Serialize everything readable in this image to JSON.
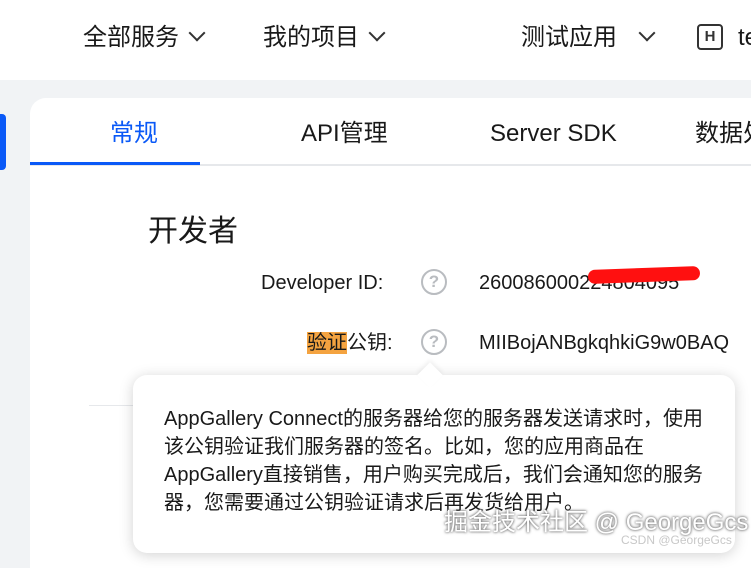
{
  "topnav": {
    "all_services": "全部服务",
    "my_projects": "我的项目",
    "app_selector": "测试应用",
    "user_badge": "H",
    "user_name_truncated": "te"
  },
  "tabs": [
    {
      "label": "常规",
      "active": true
    },
    {
      "label": "API管理",
      "active": false
    },
    {
      "label": "Server SDK",
      "active": false
    },
    {
      "label": "数据处",
      "active": false
    }
  ],
  "developer_section": {
    "title": "开发者",
    "fields": [
      {
        "label": "Developer ID:",
        "value": "260086000224804095"
      },
      {
        "label_highlight": "验证",
        "label_rest": "公钥:",
        "value": "MIIBojANBgkqhkiG9w0BAQ"
      }
    ]
  },
  "tooltip": {
    "text": "AppGallery Connect的服务器给您的服务器发送请求时，使用该公钥验证我们服务器的签名。比如，您的应用商品在AppGallery直接销售，用户购买完成后，我们会通知您的服务器，您需要通过公钥验证请求后再发货给用户。"
  },
  "watermark": {
    "main": "掘金技术社区 @ GeorgeGcs",
    "small": "CSDN @GeorgeGcs"
  },
  "colors": {
    "accent": "#0a59f7",
    "highlight": "#f4a340",
    "redaction": "#ff1010",
    "page_bg": "#f1f3f5"
  }
}
